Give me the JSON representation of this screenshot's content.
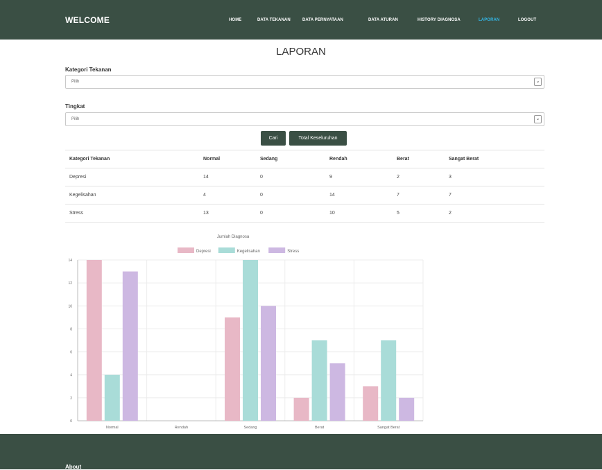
{
  "header": {
    "brand": "WELCOME",
    "nav": [
      {
        "label": "HOME",
        "active": false
      },
      {
        "label": "DATA TEKANAN",
        "active": false
      },
      {
        "label": "DATA PERNYATAAN",
        "active": false
      },
      {
        "label": "DATA ATURAN",
        "active": false
      },
      {
        "label": "HISTORY DIAGNOSA",
        "active": false
      },
      {
        "label": "LAPORAN",
        "active": true
      },
      {
        "label": "LOGOUT",
        "active": false
      }
    ]
  },
  "page": {
    "title": "LAPORAN"
  },
  "filters": {
    "kategori": {
      "label": "Kategori Tekanan",
      "value": "Pilih"
    },
    "tingkat": {
      "label": "Tingkat",
      "value": "Pilih"
    }
  },
  "buttons": {
    "cari": "Cari",
    "total": "Total Keseluruhan"
  },
  "table": {
    "headers": [
      "Kategori Tekanan",
      "Normal",
      "Sedang",
      "Rendah",
      "Berat",
      "Sangat Berat"
    ],
    "rows": [
      [
        "Depresi",
        "14",
        "0",
        "9",
        "2",
        "3"
      ],
      [
        "Kegelisahan",
        "4",
        "0",
        "14",
        "7",
        "7"
      ],
      [
        "Stress",
        "13",
        "0",
        "10",
        "5",
        "2"
      ]
    ]
  },
  "chart_data": {
    "type": "bar",
    "title": "Jumlah Diagnosa",
    "categories": [
      "Normal",
      "Rendah",
      "Sedang",
      "Berat",
      "Sangat Berat"
    ],
    "series": [
      {
        "name": "Depresi",
        "values": [
          14,
          0,
          9,
          2,
          3
        ],
        "color": "#e8b8c6"
      },
      {
        "name": "Kegelisahan",
        "values": [
          4,
          0,
          14,
          7,
          7
        ],
        "color": "#a9dcd8"
      },
      {
        "name": "Stress",
        "values": [
          13,
          0,
          10,
          5,
          2
        ],
        "color": "#cdb8e2"
      }
    ],
    "ylim": [
      0,
      14
    ],
    "yticks": [
      0,
      2,
      4,
      6,
      8,
      10,
      12,
      14
    ],
    "grid": true,
    "legend": "top"
  },
  "footer": {
    "about": "About"
  },
  "colors": {
    "primary": "#3a4f44",
    "active_nav": "#33b5e5"
  }
}
